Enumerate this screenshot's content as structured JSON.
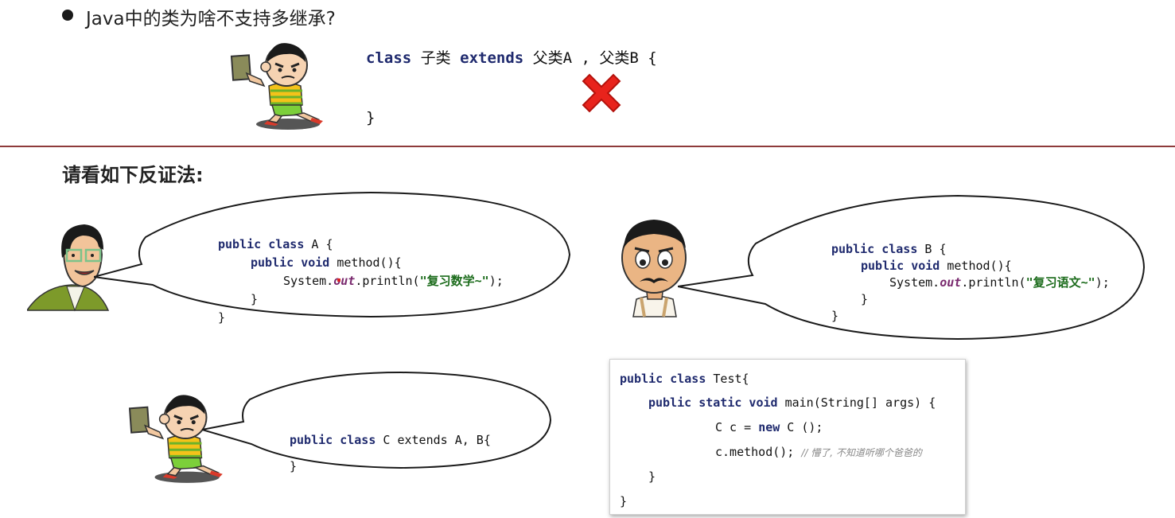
{
  "question": {
    "text": "Java中的类为啥不支持多继承?"
  },
  "top_code": {
    "kw_class": "class",
    "subclass": "子类",
    "kw_extends": "extends",
    "parents": "父类A , 父类B {",
    "close": "}"
  },
  "heading": "请看如下反证法:",
  "class_a": {
    "l1_kw": "public class",
    "l1_rest": " A {",
    "l2_kw": "public void",
    "l2_rest": " method(){",
    "l3_pre": "System.",
    "l3_out": "out",
    "l3_mid": ".println(",
    "l3_str": "\"复习数学~\"",
    "l3_end": ");",
    "l4": "}",
    "l5": "}"
  },
  "class_b": {
    "l1_kw": "public class",
    "l1_rest": " B {",
    "l2_kw": "public void",
    "l2_rest": " method(){",
    "l3_pre": "System.",
    "l3_out": "out",
    "l3_mid": ".println(",
    "l3_str": "\"复习语文~\"",
    "l3_end": ");",
    "l4": "}",
    "l5": "}"
  },
  "class_c": {
    "l1_kw": "public class",
    "l1_rest": " C extends A, B{",
    "l2": "}"
  },
  "test": {
    "l1_kw": "public class",
    "l1_rest": " Test{",
    "l2_kw": "public static void",
    "l2_rest": " main(String[] args) {",
    "l3_a": "C c = ",
    "l3_kw": "new",
    "l3_b": " C ();",
    "l4": "c.method();",
    "l4_comment": "// 懵了, 不知道听哪个爸爸的",
    "l5": "}",
    "l6": "}"
  },
  "colors": {
    "keyword": "#1f2a6e",
    "string": "#1b6b1b",
    "field_italic": "#7a2a6f",
    "divider": "#8e3b3b",
    "cross": "#e8231c"
  },
  "icons": [
    "cartoon-boy-with-book",
    "red-cross-icon",
    "cartoon-teacher-with-glasses",
    "cartoon-man-mustache",
    "speech-bubble"
  ]
}
